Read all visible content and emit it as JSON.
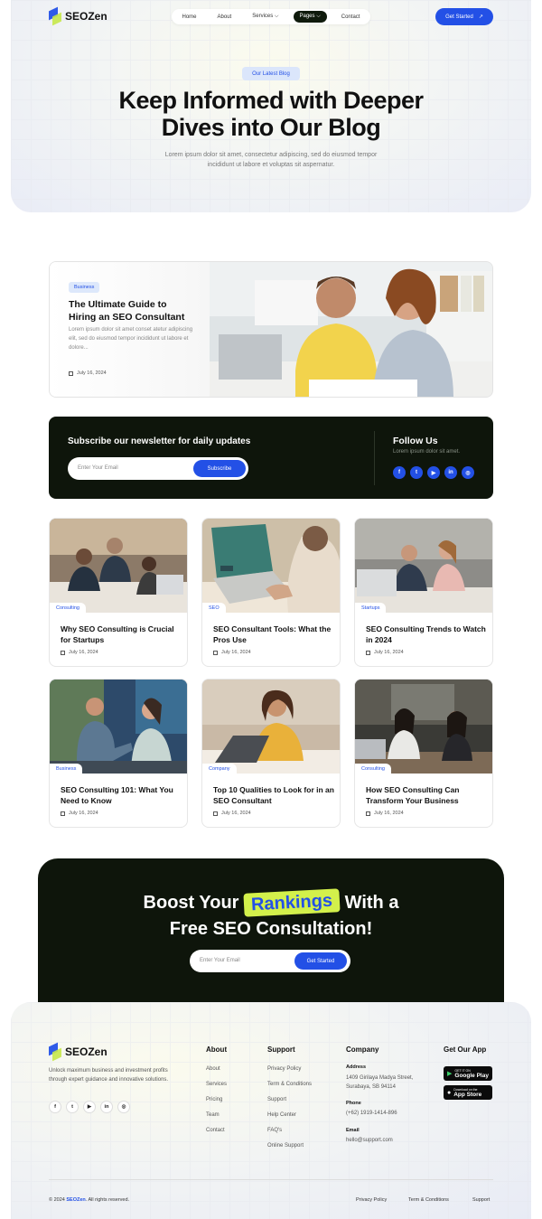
{
  "brand": {
    "name": "SEOZen",
    "primary": "#2350e6",
    "dark": "#0e150b",
    "accent": "#d3f04b"
  },
  "nav": {
    "items": [
      {
        "label": "Home"
      },
      {
        "label": "About"
      },
      {
        "label": "Services"
      },
      {
        "label": "Pages"
      },
      {
        "label": "Contact"
      }
    ],
    "cta_label": "Get Started"
  },
  "hero": {
    "badge": "Our Latest Blog",
    "title": "Keep Informed with Deeper Dives into Our Blog",
    "subtitle": "Lorem ipsum dolor sit amet, consectetur adipiscing, sed do eiusmod tempor incididunt ut labore et voluptas sit aspernatur."
  },
  "featured": {
    "tag": "Business",
    "title": "The Ultimate Guide to Hiring an SEO Consultant",
    "excerpt": "Lorem ipsum dolor sit amet conset atetur adipiscing elit, sed do eiusmod tempor incididunt ut labore et dolore...",
    "date": "July 16, 2024"
  },
  "newsletter": {
    "heading": "Subscribe our newsletter for daily updates",
    "placeholder": "Enter Your Email",
    "button": "Subscribe",
    "follow_heading": "Follow Us",
    "follow_sub": "Lorem ipsum dolor sit amet.",
    "social_icons": [
      "facebook-icon",
      "twitter-icon",
      "youtube-icon",
      "linkedin-icon",
      "dribbble-icon"
    ]
  },
  "posts": [
    {
      "category": "Consulting",
      "title": "Why SEO Consulting is Crucial for Startups",
      "date": "July 16, 2024"
    },
    {
      "category": "SEO",
      "title": "SEO Consultant Tools: What the Pros Use",
      "date": "July 16, 2024"
    },
    {
      "category": "Startups",
      "title": "SEO Consulting Trends to Watch in 2024",
      "date": "July 16, 2024"
    },
    {
      "category": "Business",
      "title": "SEO Consulting 101: What You Need to Know",
      "date": "July 16, 2024"
    },
    {
      "category": "Company",
      "title": "Top 10 Qualities to Look for in an SEO Consultant",
      "date": "July 16, 2024"
    },
    {
      "category": "Consulting",
      "title": "How SEO Consulting Can Transform Your Business",
      "date": "July 16, 2024"
    }
  ],
  "cta": {
    "title_before": "Boost Your",
    "title_highlight": "Rankings",
    "title_after": "With a",
    "title_line2": "Free SEO Consultation!",
    "placeholder": "Enter Your Email",
    "button": "Get Started"
  },
  "footer": {
    "description": "Unlock maximum business and investment profits through expert guidance and innovative solutions.",
    "about": {
      "heading": "About",
      "links": [
        "About",
        "Services",
        "Pricing",
        "Team",
        "Contact"
      ]
    },
    "support": {
      "heading": "Support",
      "links": [
        "Privacy Policy",
        "Term & Conditions",
        "Support",
        "Help Center",
        "FAQ's",
        "Online Support"
      ]
    },
    "company": {
      "heading": "Company",
      "address_label": "Address",
      "address": "1409 Girilaya Madya Street, Surabaya, SB 94114",
      "phone_label": "Phone",
      "phone": "(+62) 1919-1414-896",
      "email_label": "Email",
      "email": "hello@support.com"
    },
    "app": {
      "heading": "Get Our App",
      "google_small": "GET IT ON",
      "google_big": "Google Play",
      "apple_small": "Download on the",
      "apple_big": "App Store"
    },
    "copyright_prefix": "© 2024",
    "copyright_brand": "SEOZen",
    "copyright_suffix": ". All rights reserved.",
    "bottom_links": [
      "Privacy Policy",
      "Term & Conditions",
      "Support"
    ]
  }
}
